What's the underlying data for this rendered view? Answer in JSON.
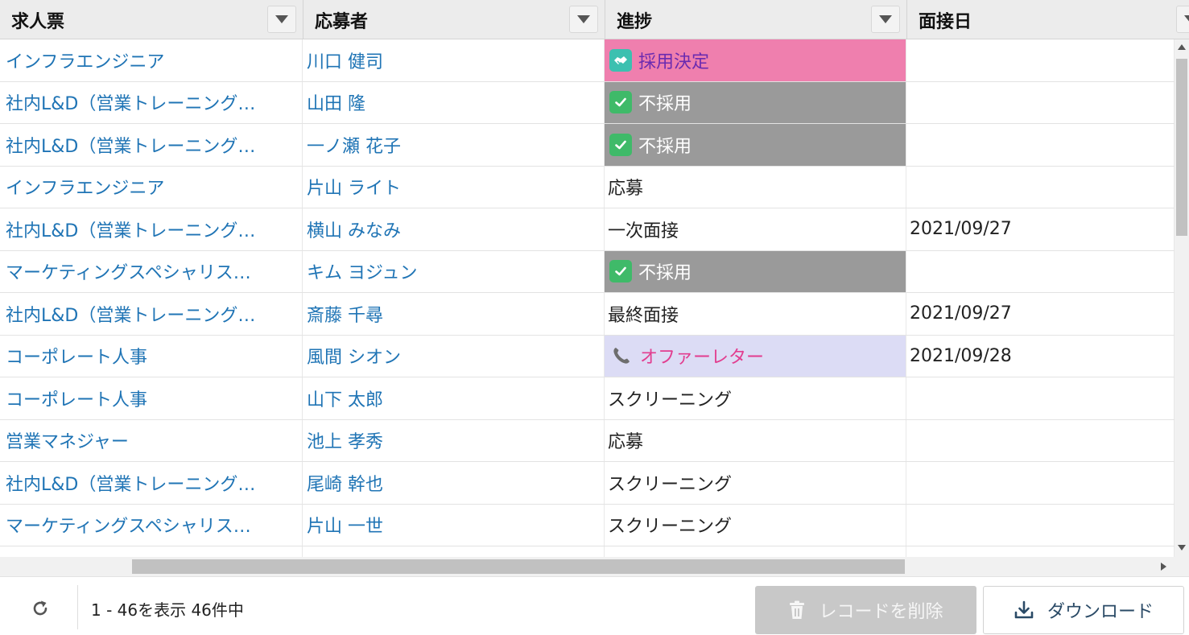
{
  "columns": [
    {
      "label": "求人票"
    },
    {
      "label": "応募者"
    },
    {
      "label": "進捗"
    },
    {
      "label": "面接日"
    }
  ],
  "rows": [
    {
      "job": "インフラエンジニア",
      "applicant": "川口 健司",
      "status": "採用決定",
      "status_style": "hired",
      "date": ""
    },
    {
      "job": "社内L&D（営業トレーニング…",
      "applicant": "山田 隆",
      "status": "不採用",
      "status_style": "rejected",
      "date": ""
    },
    {
      "job": "社内L&D（営業トレーニング…",
      "applicant": "一ノ瀬 花子",
      "status": "不採用",
      "status_style": "rejected",
      "date": ""
    },
    {
      "job": "インフラエンジニア",
      "applicant": "片山 ライト",
      "status": "応募",
      "status_style": "plain",
      "date": ""
    },
    {
      "job": "社内L&D（営業トレーニング…",
      "applicant": "横山 みなみ",
      "status": "一次面接",
      "status_style": "plain",
      "date": "2021/09/27"
    },
    {
      "job": "マーケティングスペシャリス…",
      "applicant": "キム ヨジュン",
      "status": "不採用",
      "status_style": "rejected",
      "date": ""
    },
    {
      "job": "社内L&D（営業トレーニング…",
      "applicant": "斎藤 千尋",
      "status": "最終面接",
      "status_style": "plain",
      "date": "2021/09/27"
    },
    {
      "job": "コーポレート人事",
      "applicant": "風間 シオン",
      "status": "オファーレター",
      "status_style": "offer",
      "date": "2021/09/28"
    },
    {
      "job": "コーポレート人事",
      "applicant": "山下 太郎",
      "status": "スクリーニング",
      "status_style": "plain",
      "date": ""
    },
    {
      "job": "営業マネジャー",
      "applicant": "池上 孝秀",
      "status": "応募",
      "status_style": "plain",
      "date": ""
    },
    {
      "job": "社内L&D（営業トレーニング…",
      "applicant": "尾崎 幹也",
      "status": "スクリーニング",
      "status_style": "plain",
      "date": ""
    },
    {
      "job": "マーケティングスペシャリス…",
      "applicant": "片山 一世",
      "status": "スクリーニング",
      "status_style": "plain",
      "date": ""
    }
  ],
  "footer": {
    "record_count": "1 - 46を表示 46件中",
    "delete_label": "レコードを削除",
    "download_label": "ダウンロード"
  },
  "icons": {
    "hired": "handshake-icon",
    "rejected": "check-icon",
    "offer": "phone-icon",
    "refresh": "refresh-icon",
    "delete": "trash-icon",
    "download": "download-icon",
    "column_menu": "chevron-down-icon"
  },
  "colors": {
    "link": "#1f74b5",
    "hired_bg": "#ef7fae",
    "hired_text": "#6b2bb0",
    "rejected_bg": "#9a9a9a",
    "offer_bg": "#dcdcf5",
    "offer_text": "#e23d8f",
    "check_icon": "#3fba69",
    "handshake_icon": "#3cc0b0"
  }
}
